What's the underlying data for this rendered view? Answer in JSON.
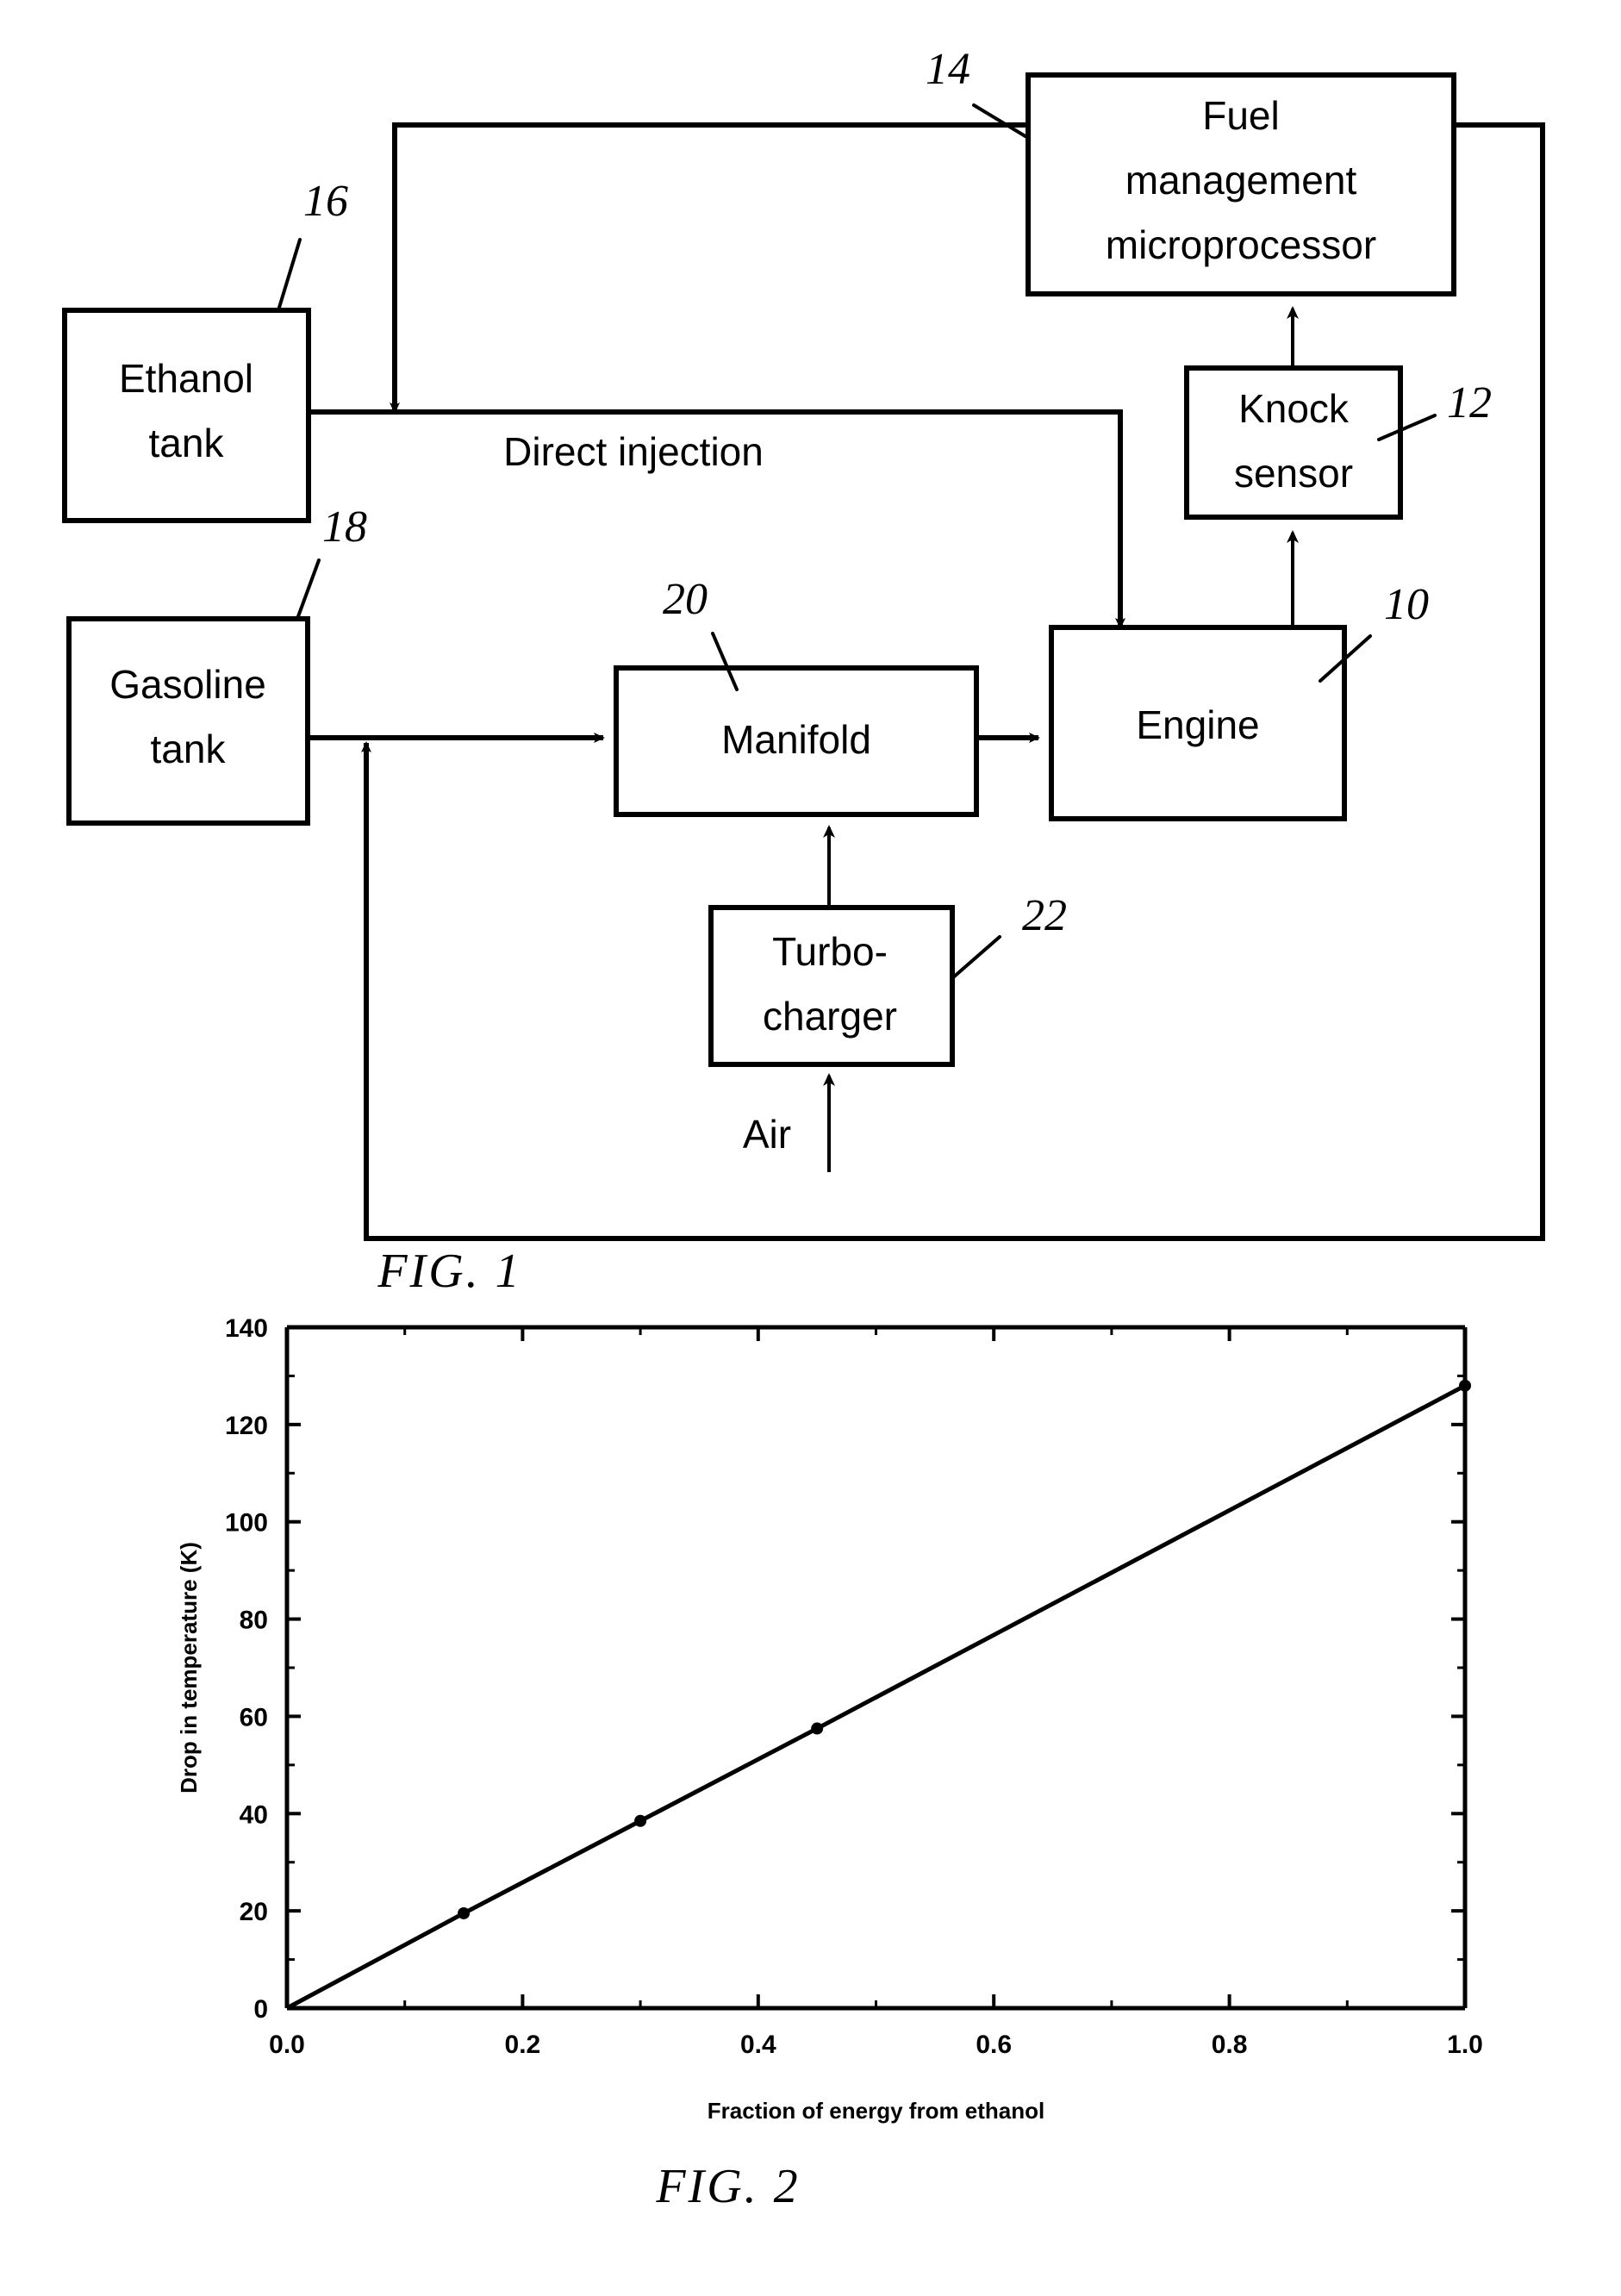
{
  "figure1": {
    "caption": "FIG. 1",
    "blocks": [
      {
        "id": "fuel_management",
        "label_line1": "Fuel",
        "label_line2": "management",
        "label_line3": "microprocessor",
        "ref": "14"
      },
      {
        "id": "ethanol_tank",
        "label_line1": "Ethanol",
        "label_line2": "tank",
        "ref": "16"
      },
      {
        "id": "knock_sensor",
        "label_line1": "Knock",
        "label_line2": "sensor",
        "ref": "12"
      },
      {
        "id": "gasoline_tank",
        "label_line1": "Gasoline",
        "label_line2": "tank",
        "ref": "18"
      },
      {
        "id": "manifold",
        "label_line1": "Manifold",
        "ref": "20"
      },
      {
        "id": "engine",
        "label_line1": "Engine",
        "ref": "10"
      },
      {
        "id": "turbocharger",
        "label_line1": "Turbo-",
        "label_line2": "charger",
        "ref": "22"
      }
    ],
    "flow_labels": {
      "direct_injection": "Direct injection",
      "air": "Air"
    }
  },
  "figure2": {
    "caption": "FIG. 2"
  },
  "chart_data": {
    "type": "line",
    "title": "",
    "xlabel": "Fraction of energy from ethanol",
    "ylabel": "Drop in temperature (K)",
    "xlim": [
      0.0,
      1.0
    ],
    "ylim": [
      0,
      140
    ],
    "xticks": [
      "0.0",
      "0.2",
      "0.4",
      "0.6",
      "0.8",
      "1.0"
    ],
    "xtick_values": [
      0.0,
      0.2,
      0.4,
      0.6,
      0.8,
      1.0
    ],
    "yticks": [
      "0",
      "20",
      "40",
      "60",
      "80",
      "100",
      "120",
      "140"
    ],
    "ytick_values": [
      0,
      20,
      40,
      60,
      80,
      100,
      120,
      140
    ],
    "grid": false,
    "legend": "none",
    "series": [
      {
        "name": "Drop in temperature",
        "x": [
          0.0,
          0.15,
          0.3,
          0.45,
          1.0
        ],
        "values": [
          0,
          19.5,
          38.5,
          57.5,
          128
        ],
        "marker": "circle"
      }
    ]
  }
}
